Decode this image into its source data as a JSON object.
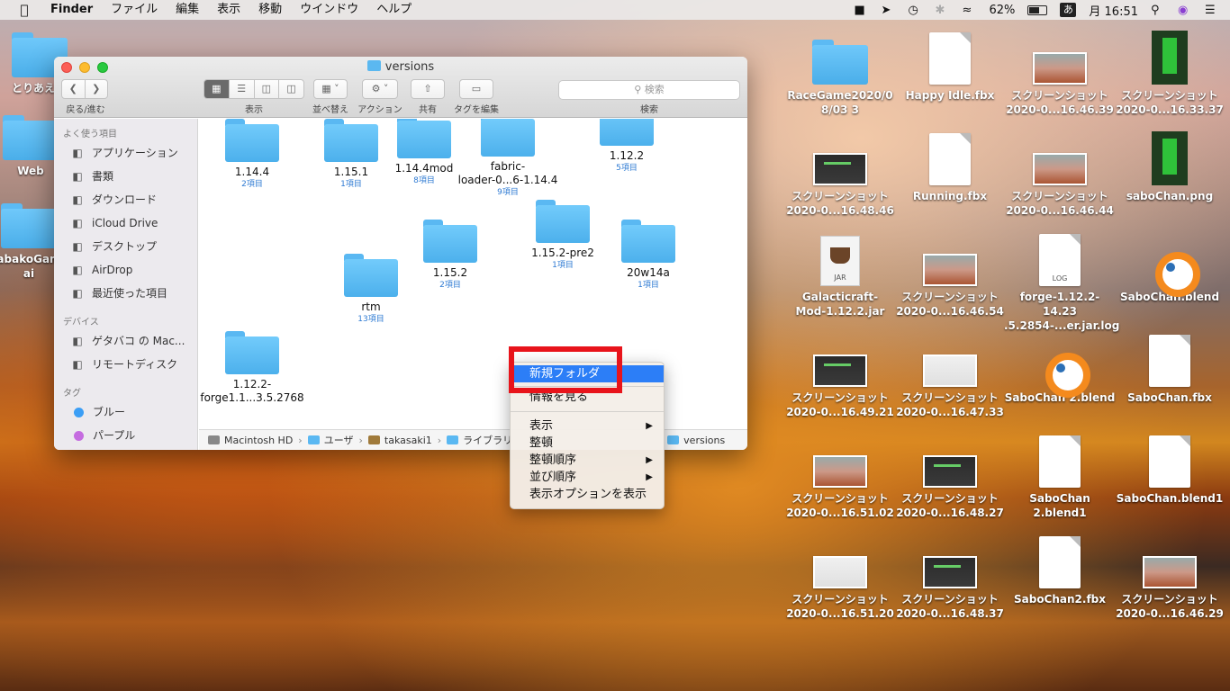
{
  "menubar": {
    "app_name": "Finder",
    "menus": [
      "ファイル",
      "編集",
      "表示",
      "移動",
      "ウインドウ",
      "ヘルプ"
    ],
    "battery_percent": "62%",
    "ime": "あ",
    "clock": "月 16:51"
  },
  "finder": {
    "title": "versions",
    "toolbar": {
      "back_forward_label": "戻る/進む",
      "view_label": "表示",
      "arrange_label": "並べ替え",
      "action_label": "アクション",
      "share_label": "共有",
      "tags_label": "タグを編集",
      "search_label": "検索",
      "search_placeholder": "検索"
    },
    "sidebar": {
      "favorites_header": "よく使う項目",
      "favorites": [
        {
          "label": "アプリケーション",
          "icon": "applications-icon"
        },
        {
          "label": "書類",
          "icon": "documents-icon"
        },
        {
          "label": "ダウンロード",
          "icon": "downloads-icon"
        },
        {
          "label": "iCloud Drive",
          "icon": "icloud-icon"
        },
        {
          "label": "デスクトップ",
          "icon": "desktop-icon"
        },
        {
          "label": "AirDrop",
          "icon": "airdrop-icon"
        },
        {
          "label": "最近使った項目",
          "icon": "recents-icon"
        }
      ],
      "devices_header": "デバイス",
      "devices": [
        {
          "label": "ゲタバコ の Mac...",
          "icon": "computer-icon"
        },
        {
          "label": "リモートディスク",
          "icon": "remote-disc-icon"
        }
      ],
      "tags_header": "タグ",
      "tags": [
        {
          "label": "ブルー",
          "color": "#3b9ef5"
        },
        {
          "label": "パープル",
          "color": "#c56ce0"
        }
      ]
    },
    "items": [
      {
        "name": "1.14.4",
        "count": "2項目"
      },
      {
        "name": "1.15.1",
        "count": "1項目"
      },
      {
        "name": "1.14.4mod",
        "count": "8項目"
      },
      {
        "name": "fabric-",
        "name2": "loader-0...6-1.14.4",
        "count": "9項目"
      },
      {
        "name": "1.12.2",
        "count": "5項目"
      },
      {
        "name": "1.15.2-pre2",
        "count": "1項目"
      },
      {
        "name": "1.15.2",
        "count": "2項目"
      },
      {
        "name": "20w14a",
        "count": "1項目"
      },
      {
        "name": "rtm",
        "count": "13項目"
      },
      {
        "name": "1.12.2-",
        "name2": "forge1.1...3.5.2768",
        "count": ""
      }
    ],
    "pathbar": [
      "Macintosh HD",
      "ユーザ",
      "takasaki1",
      "ライブラリ",
      "versions"
    ]
  },
  "context_menu": {
    "new_folder": "新規フォルダ",
    "get_info": "情報を見る",
    "view": "表示",
    "clean_up": "整頓",
    "clean_up_by": "整頓順序",
    "sort_by": "並び順序",
    "show_view_options": "表示オプションを表示"
  },
  "desktop": {
    "left_icons": [
      "とりあえ...",
      "Web",
      "abakoGam ai"
    ],
    "icons": [
      {
        "l1": "RaceGame2020/0",
        "l2": "8/03 3"
      },
      {
        "l1": "Happy Idle.fbx",
        "l2": ""
      },
      {
        "l1": "スクリーンショット",
        "l2": "2020-0...16.46.39"
      },
      {
        "l1": "スクリーンショット",
        "l2": "2020-0...16.33.37"
      },
      {
        "l1": "スクリーンショット",
        "l2": "2020-0...16.48.46"
      },
      {
        "l1": "Running.fbx",
        "l2": ""
      },
      {
        "l1": "スクリーンショット",
        "l2": "2020-0...16.46.44"
      },
      {
        "l1": "saboChan.png",
        "l2": ""
      },
      {
        "l1": "Galacticraft-",
        "l2": "Mod-1.12.2.jar"
      },
      {
        "l1": "スクリーンショット",
        "l2": "2020-0...16.46.54"
      },
      {
        "l1": "forge-1.12.2-14.23",
        "l2": ".5.2854-...er.jar.log"
      },
      {
        "l1": "SaboChan.blend",
        "l2": ""
      },
      {
        "l1": "スクリーンショット",
        "l2": "2020-0...16.49.21"
      },
      {
        "l1": "スクリーンショット",
        "l2": "2020-0...16.47.33"
      },
      {
        "l1": "SaboChan 2.blend",
        "l2": ""
      },
      {
        "l1": "SaboChan.fbx",
        "l2": ""
      },
      {
        "l1": "スクリーンショット",
        "l2": "2020-0...16.51.02"
      },
      {
        "l1": "スクリーンショット",
        "l2": "2020-0...16.48.27"
      },
      {
        "l1": "SaboChan",
        "l2": "2.blend1"
      },
      {
        "l1": "SaboChan.blend1",
        "l2": ""
      },
      {
        "l1": "スクリーンショット",
        "l2": "2020-0...16.51.20"
      },
      {
        "l1": "スクリーンショット",
        "l2": "2020-0...16.48.37"
      },
      {
        "l1": "SaboChan2.fbx",
        "l2": ""
      },
      {
        "l1": "スクリーンショット",
        "l2": "2020-0...16.46.29"
      }
    ],
    "jar_tag": "JAR",
    "log_tag": "LOG"
  }
}
